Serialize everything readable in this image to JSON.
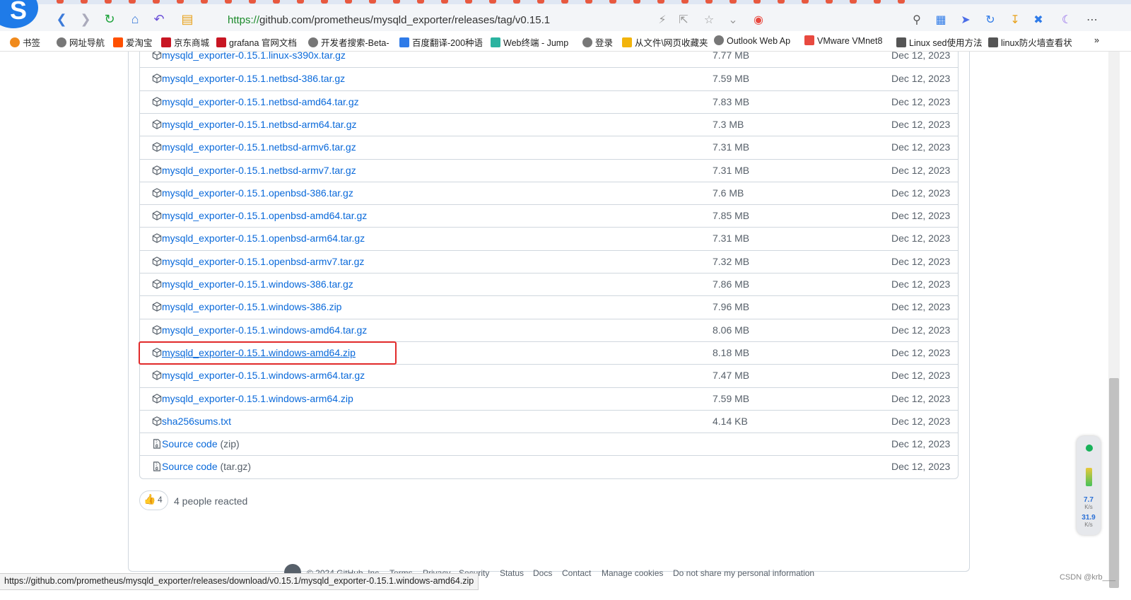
{
  "browser": {
    "url_protocol": "https://",
    "url_rest": "github.com/prometheus/mysqld_exporter/releases/tag/v0.15.1",
    "bookmarks": [
      {
        "label": "书签",
        "color": "#f08a1c"
      },
      {
        "label": "网址导航",
        "color": "#666666"
      },
      {
        "label": "爱淘宝",
        "color": "#ff5000"
      },
      {
        "label": "京东商城",
        "color": "#c81623"
      },
      {
        "label": "grafana 官网文档",
        "color": "#c81623"
      },
      {
        "label": "开发者搜索-Beta-",
        "color": "#666666"
      },
      {
        "label": "百度翻译-200种语",
        "color": "#2f7be8"
      },
      {
        "label": "Web终端 - Jump",
        "color": "#2bb3a0"
      },
      {
        "label": "登录",
        "color": "#666666"
      },
      {
        "label": "从文件\\网页收藏夹",
        "color": "#f2b40c"
      },
      {
        "label": "Outlook Web Ap",
        "color": "#666666"
      },
      {
        "label": "VMware VMnet8",
        "color": "#e8493f"
      },
      {
        "label": "Linux sed使用方法",
        "color": "#666666"
      },
      {
        "label": "linux防火墙查看状",
        "color": "#666666"
      }
    ],
    "more_label": "»"
  },
  "assets": [
    {
      "name": "mysqld_exporter-0.15.1.linux-s390x.tar.gz",
      "suffix": "",
      "size": "7.77 MB",
      "date": "Dec 12, 2023",
      "icon": "package-icon"
    },
    {
      "name": "mysqld_exporter-0.15.1.netbsd-386.tar.gz",
      "suffix": "",
      "size": "7.59 MB",
      "date": "Dec 12, 2023",
      "icon": "package-icon"
    },
    {
      "name": "mysqld_exporter-0.15.1.netbsd-amd64.tar.gz",
      "suffix": "",
      "size": "7.83 MB",
      "date": "Dec 12, 2023",
      "icon": "package-icon"
    },
    {
      "name": "mysqld_exporter-0.15.1.netbsd-arm64.tar.gz",
      "suffix": "",
      "size": "7.3 MB",
      "date": "Dec 12, 2023",
      "icon": "package-icon"
    },
    {
      "name": "mysqld_exporter-0.15.1.netbsd-armv6.tar.gz",
      "suffix": "",
      "size": "7.31 MB",
      "date": "Dec 12, 2023",
      "icon": "package-icon"
    },
    {
      "name": "mysqld_exporter-0.15.1.netbsd-armv7.tar.gz",
      "suffix": "",
      "size": "7.31 MB",
      "date": "Dec 12, 2023",
      "icon": "package-icon"
    },
    {
      "name": "mysqld_exporter-0.15.1.openbsd-386.tar.gz",
      "suffix": "",
      "size": "7.6 MB",
      "date": "Dec 12, 2023",
      "icon": "package-icon"
    },
    {
      "name": "mysqld_exporter-0.15.1.openbsd-amd64.tar.gz",
      "suffix": "",
      "size": "7.85 MB",
      "date": "Dec 12, 2023",
      "icon": "package-icon"
    },
    {
      "name": "mysqld_exporter-0.15.1.openbsd-arm64.tar.gz",
      "suffix": "",
      "size": "7.31 MB",
      "date": "Dec 12, 2023",
      "icon": "package-icon"
    },
    {
      "name": "mysqld_exporter-0.15.1.openbsd-armv7.tar.gz",
      "suffix": "",
      "size": "7.32 MB",
      "date": "Dec 12, 2023",
      "icon": "package-icon"
    },
    {
      "name": "mysqld_exporter-0.15.1.windows-386.tar.gz",
      "suffix": "",
      "size": "7.86 MB",
      "date": "Dec 12, 2023",
      "icon": "package-icon"
    },
    {
      "name": "mysqld_exporter-0.15.1.windows-386.zip",
      "suffix": "",
      "size": "7.96 MB",
      "date": "Dec 12, 2023",
      "icon": "package-icon"
    },
    {
      "name": "mysqld_exporter-0.15.1.windows-amd64.tar.gz",
      "suffix": "",
      "size": "8.06 MB",
      "date": "Dec 12, 2023",
      "icon": "package-icon"
    },
    {
      "name": "mysqld_exporter-0.15.1.windows-amd64.zip",
      "suffix": "",
      "size": "8.18 MB",
      "date": "Dec 12, 2023",
      "icon": "package-icon",
      "highlighted": true
    },
    {
      "name": "mysqld_exporter-0.15.1.windows-arm64.tar.gz",
      "suffix": "",
      "size": "7.47 MB",
      "date": "Dec 12, 2023",
      "icon": "package-icon"
    },
    {
      "name": "mysqld_exporter-0.15.1.windows-arm64.zip",
      "suffix": "",
      "size": "7.59 MB",
      "date": "Dec 12, 2023",
      "icon": "package-icon"
    },
    {
      "name": "sha256sums.txt",
      "suffix": "",
      "size": "4.14 KB",
      "date": "Dec 12, 2023",
      "icon": "package-icon"
    },
    {
      "name": "Source code",
      "suffix": " (zip)",
      "size": "",
      "date": "Dec 12, 2023",
      "icon": "file-zip-icon"
    },
    {
      "name": "Source code",
      "suffix": " (tar.gz)",
      "size": "",
      "date": "Dec 12, 2023",
      "icon": "file-zip-icon"
    }
  ],
  "reactions": {
    "emoji": "👍",
    "count": "4",
    "text": "4 people reacted"
  },
  "footer": {
    "copyright": "© 2024 GitHub, Inc.",
    "links": [
      "Terms",
      "Privacy",
      "Security",
      "Status",
      "Docs",
      "Contact",
      "Manage cookies",
      "Do not share my personal information"
    ]
  },
  "status_url": "https://github.com/prometheus/mysqld_exporter/releases/download/v0.15.1/mysqld_exporter-0.15.1.windows-amd64.zip",
  "watermark": "CSDN @krb___",
  "net_widget": {
    "up": "7.7",
    "down": "31.9",
    "unit": "K/s"
  },
  "colors": {
    "link": "#0969da",
    "muted": "#57606a",
    "highlight": "#e12a2a"
  }
}
